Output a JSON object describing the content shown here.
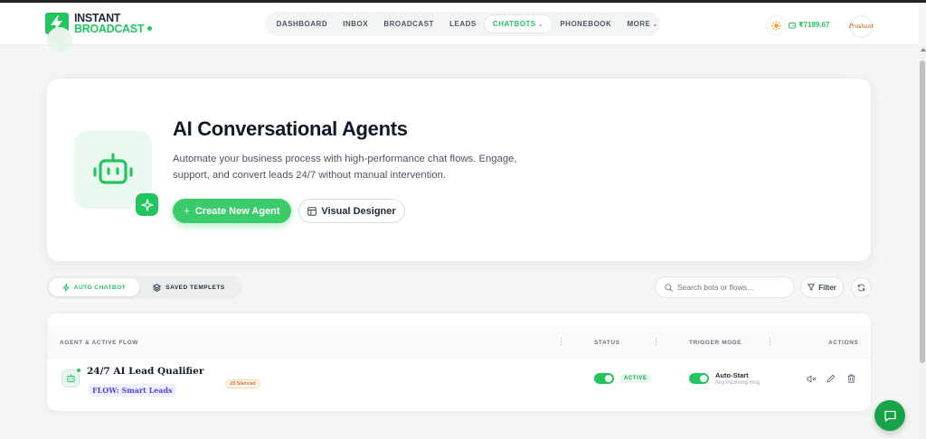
{
  "brand": {
    "line1": "INSTANT",
    "line2": "BROADCAST",
    "accent": "#22c55e"
  },
  "nav": {
    "items": [
      {
        "label": "DASHBOARD"
      },
      {
        "label": "INBOX"
      },
      {
        "label": "BROADCAST"
      },
      {
        "label": "LEADS"
      },
      {
        "label": "CHATBOTS",
        "active": true
      },
      {
        "label": "PHONEBOOK"
      },
      {
        "label": "MORE"
      }
    ]
  },
  "header": {
    "balance": "₹7189.67",
    "avatar_text": "Prashant"
  },
  "hero": {
    "title": "AI Conversational Agents",
    "description": "Automate your business process with high-performance chat flows. Engage, support, and convert leads 24/7 without manual intervention.",
    "create_label": "Create New Agent",
    "create_plus": "+",
    "visual_label": "Visual Designer"
  },
  "tabs": {
    "auto": "AUTO CHATBOT",
    "saved": "SAVED TEMPLETS"
  },
  "toolbar": {
    "search_placeholder": "Search bots or flows...",
    "filter_label": "Filter"
  },
  "table": {
    "headers": {
      "agent": "AGENT & ACTIVE FLOW",
      "status": "STATUS",
      "trigger": "TRIGGER MODE",
      "actions": "ACTIONS"
    },
    "rows": [
      {
        "name": "24/7 AI Lead Qualifier",
        "flow": "FLOW: Smart Leads",
        "silenced": "28 Silenced",
        "status": "ACTIVE",
        "trigger_title": "Auto-Start",
        "trigger_sub": "Any incoming msg"
      }
    ]
  }
}
